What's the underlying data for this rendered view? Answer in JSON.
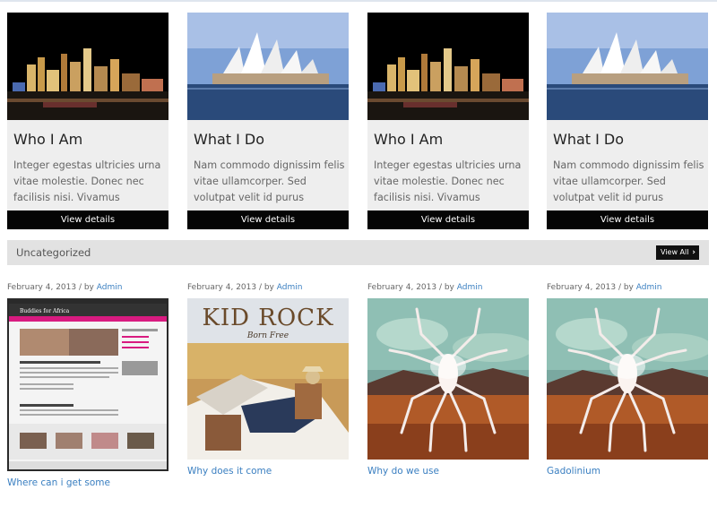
{
  "cards": [
    {
      "title": "Who I Am",
      "text": "Integer egestas ultricies urna vitae molestie. Donec nec facilisis nisi. Vivamus",
      "button": "View details",
      "image": "city-night-image"
    },
    {
      "title": "What I Do",
      "text": "Nam commodo dignissim felis vitae ullamcorper. Sed volutpat velit id purus",
      "button": "View details",
      "image": "opera-house-image"
    },
    {
      "title": "Who I Am",
      "text": "Integer egestas ultricies urna vitae molestie. Donec nec facilisis nisi. Vivamus",
      "button": "View details",
      "image": "city-night-image"
    },
    {
      "title": "What I Do",
      "text": "Nam commodo dignissim felis vitae ullamcorper. Sed volutpat velit id purus",
      "button": "View details",
      "image": "opera-house-image"
    }
  ],
  "section": {
    "title": "Uncategorized",
    "view_all": "View All",
    "view_all_icon": "chevron-right-icon"
  },
  "posts": [
    {
      "date": "February 4, 2013",
      "by": " / by ",
      "author": "Admin",
      "title": "Where can i get some",
      "thumb_text": "Buddies for Africa"
    },
    {
      "date": "February 4, 2013",
      "by": " / by ",
      "author": "Admin",
      "title": "Why does it come",
      "thumb_text": "KID ROCK",
      "thumb_subtext": "Born Free"
    },
    {
      "date": "February 4, 2013",
      "by": " / by ",
      "author": "Admin",
      "title": "Why do we use"
    },
    {
      "date": "February 4, 2013",
      "by": " / by ",
      "author": "Admin",
      "title": "Gadolinium"
    }
  ],
  "colors": {
    "link": "#3a7fc1",
    "button": "#050505",
    "card_bg": "#eeeeee",
    "bar_bg": "#e2e2e2"
  }
}
